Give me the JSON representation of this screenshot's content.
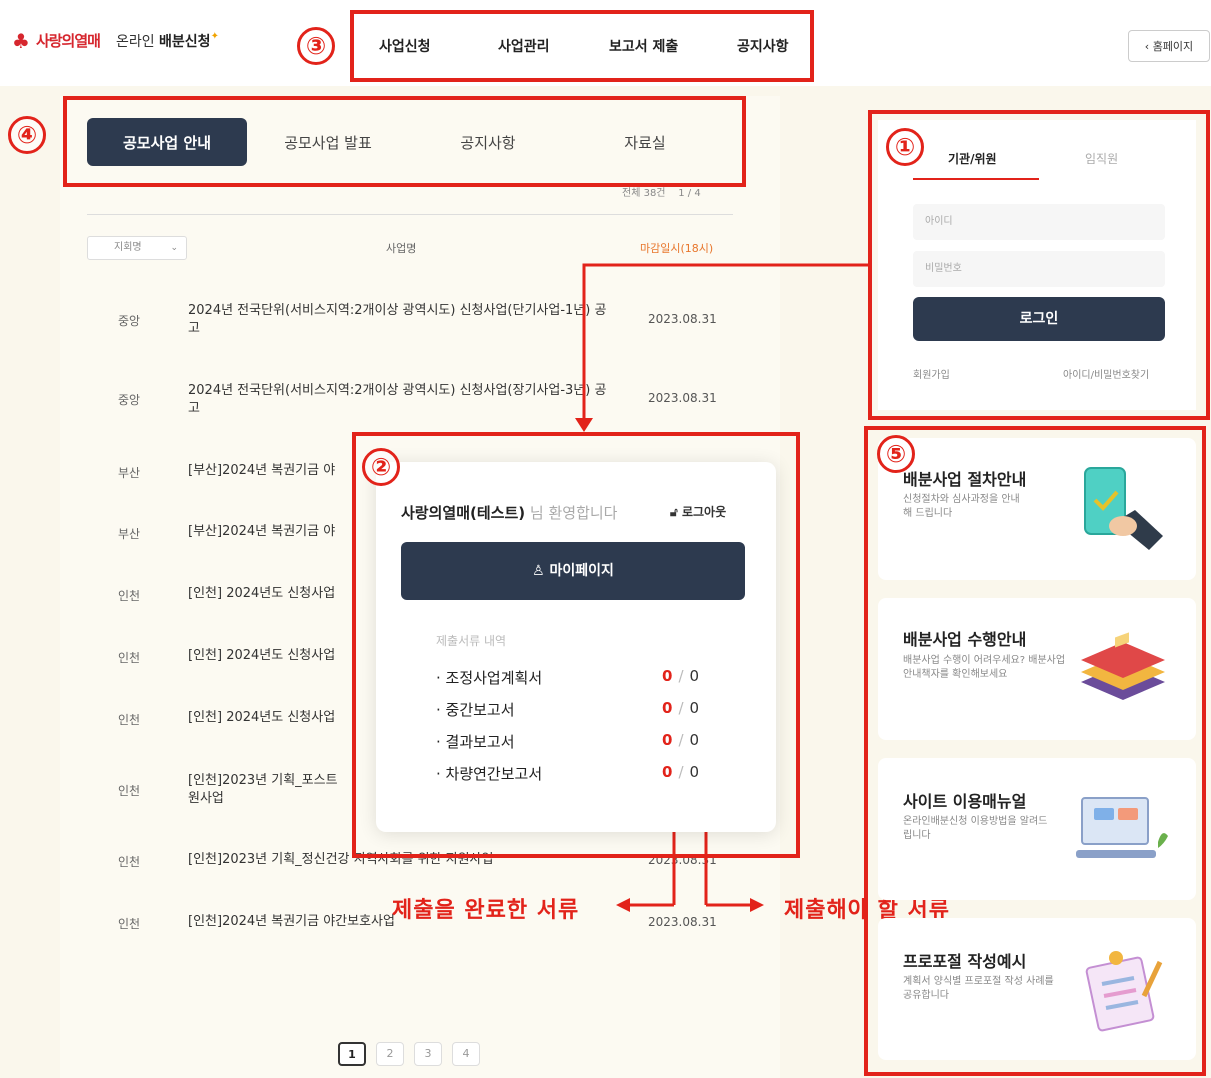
{
  "header": {
    "logo_text": "사랑의열매",
    "service_prefix": "온라인",
    "service_name": "배분신청",
    "home_button": "‹ 홈페이지"
  },
  "top_nav": [
    "사업신청",
    "사업관리",
    "보고서 제출",
    "공지사항"
  ],
  "sub_tabs": [
    "공모사업 안내",
    "공모사업 발표",
    "공지사항",
    "자료실"
  ],
  "markers": [
    "①",
    "②",
    "③",
    "④",
    "⑤"
  ],
  "list": {
    "total": "전체 38건",
    "page_info": "1 / 4",
    "region_select": "지회명",
    "col_title": "사업명",
    "col_deadline": "마감일시(18시)",
    "rows": [
      {
        "region": "중앙",
        "title": "2024년 전국단위(서비스지역:2개이상 광역시도) 신청사업(단기사업-1년) 공고",
        "date": "2023.08.31"
      },
      {
        "region": "중앙",
        "title": "2024년 전국단위(서비스지역:2개이상 광역시도) 신청사업(장기사업-3년) 공고",
        "date": "2023.08.31"
      },
      {
        "region": "부산",
        "title": "[부산]2024년 복권기금 야",
        "date": ""
      },
      {
        "region": "부산",
        "title": "[부산]2024년 복권기금 야",
        "date": ""
      },
      {
        "region": "인천",
        "title": "[인천] 2024년도 신청사업",
        "date": ""
      },
      {
        "region": "인천",
        "title": "[인천] 2024년도 신청사업",
        "date": ""
      },
      {
        "region": "인천",
        "title": "[인천] 2024년도 신청사업",
        "date": ""
      },
      {
        "region": "인천",
        "title": "[인천]2023년 기획_포스트 원사업",
        "date": ""
      },
      {
        "region": "인천",
        "title": "[인천]2023년 기획_정신건강 지역사회를 위한 지원사업",
        "date": "2023.08.31"
      },
      {
        "region": "인천",
        "title": "[인천]2024년 복권기금 야간보호사업",
        "date": "2023.08.31"
      }
    ],
    "pages": [
      "1",
      "2",
      "3",
      "4"
    ]
  },
  "login": {
    "tab_org": "기관/위원",
    "tab_staff": "임직원",
    "id_placeholder": "아이디",
    "pw_placeholder": "비밀번호",
    "login_button": "로그인",
    "signup": "회원가입",
    "find": "아이디/비밀번호찾기"
  },
  "user_card": {
    "user_name": "사랑의열매(테스트)",
    "welcome": "님 환영합니다",
    "logout": "로그아웃",
    "mypage": "마이페이지",
    "docs_heading": "제출서류 내역",
    "docs": [
      {
        "name": "· 조정사업계획서",
        "done": "0",
        "total": "0"
      },
      {
        "name": "· 중간보고서",
        "done": "0",
        "total": "0"
      },
      {
        "name": "· 결과보고서",
        "done": "0",
        "total": "0"
      },
      {
        "name": "· 차량연간보고서",
        "done": "0",
        "total": "0"
      }
    ]
  },
  "annotations": {
    "left": "제출을 완료한 서류",
    "right": "제출해야 할 서류"
  },
  "guides": [
    {
      "title": "배분사업 절차안내",
      "desc": "신청절차와 심사과정을 안내해 드립니다"
    },
    {
      "title": "배분사업 수행안내",
      "desc": "배분사업 수행이 어려우세요? 배분사업안내책자를 확인해보세요"
    },
    {
      "title": "사이트 이용매뉴얼",
      "desc": "온라인배분신청 이용방법을 알려드립니다"
    },
    {
      "title": "프로포절 작성예시",
      "desc": "계획서 양식별 프로포절 작성 사례를 공유합니다"
    }
  ],
  "colors": {
    "accent_red": "#e2231a",
    "navy": "#2d3a4f",
    "cream": "#faf7ec"
  }
}
